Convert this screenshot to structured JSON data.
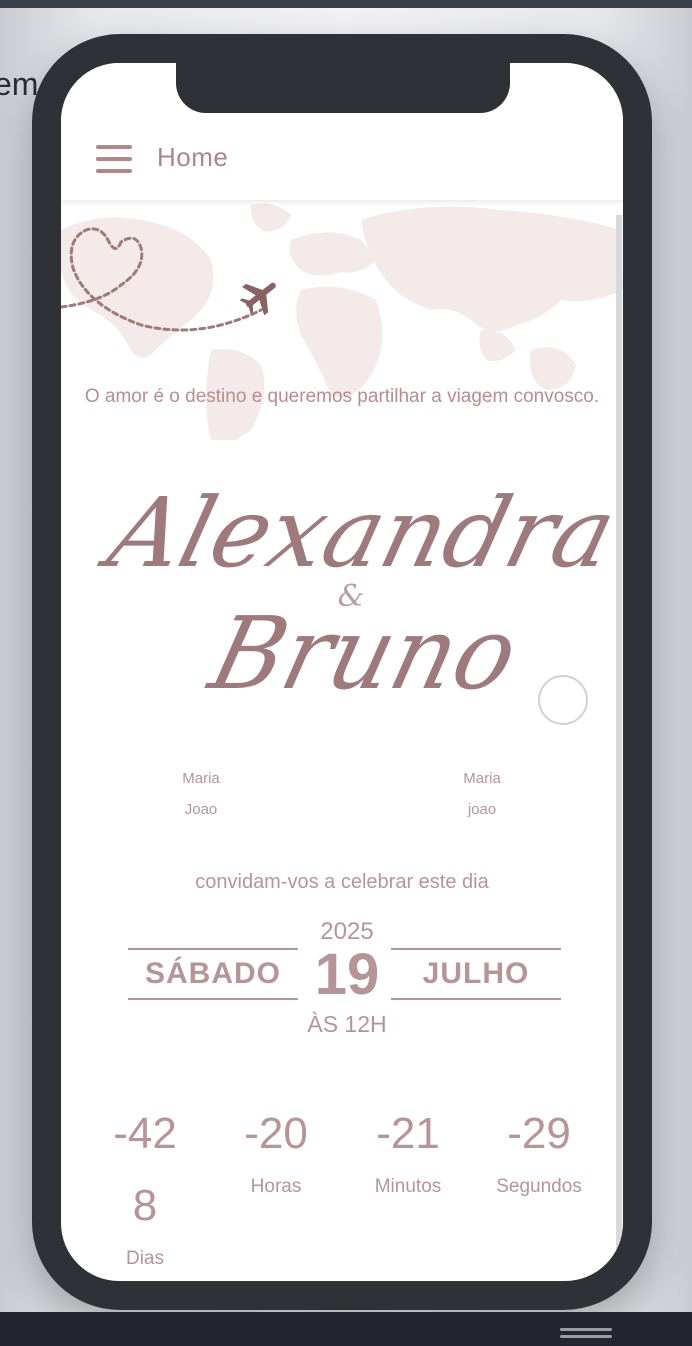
{
  "background": {
    "partial_text": "em"
  },
  "app": {
    "title": "Home",
    "tagline": "O amor é o destino e queremos partilhar a viagem convosco.",
    "bride": "Alexandra",
    "ampersand": "&",
    "groom": "Bruno",
    "parents_left": [
      "Maria",
      "Joao"
    ],
    "parents_right": [
      "Maria",
      "joao"
    ],
    "invite_text": "convidam-vos a celebrar este dia",
    "date": {
      "year": "2025",
      "weekday": "SÁBADO",
      "day": "19",
      "month": "JULHO",
      "time": "ÀS 12H"
    },
    "countdown": [
      {
        "value_line1": "-42",
        "value_line2": "8",
        "label": "Dias"
      },
      {
        "value_line1": "-20",
        "label": "Horas"
      },
      {
        "value_line1": "-21",
        "label": "Minutos"
      },
      {
        "value_line1": "-29",
        "label": "Segundos"
      }
    ]
  },
  "colors": {
    "accent": "#b69598",
    "script": "#9e7a7d",
    "map": "#f3eae9",
    "frame": "#2f3136"
  },
  "icons": [
    "menu-icon",
    "airplane-icon",
    "heart-path-icon",
    "world-map"
  ]
}
